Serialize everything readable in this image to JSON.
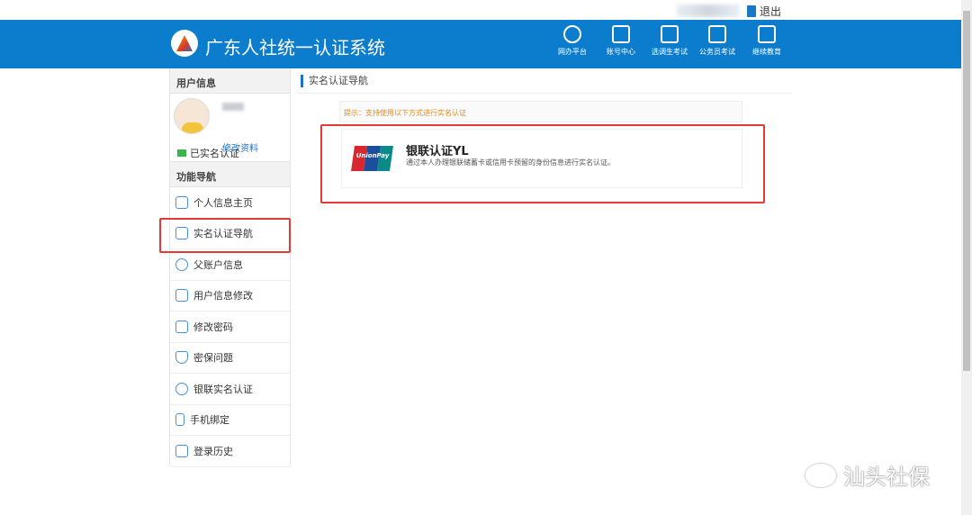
{
  "topbar": {
    "logout_label": "退出"
  },
  "header": {
    "title": "广东人社统一认证系统",
    "nav": [
      {
        "label": "网办平台",
        "icon": "person-circle-icon"
      },
      {
        "label": "账号中心",
        "icon": "account-card-icon"
      },
      {
        "label": "选调生考试",
        "icon": "exam-100-icon"
      },
      {
        "label": "公务员考试",
        "icon": "exam-100-icon"
      },
      {
        "label": "继续教育",
        "icon": "teacher-board-icon"
      }
    ]
  },
  "sidebar": {
    "user_section": "用户信息",
    "edit_profile": "修改资料",
    "verified": "已实名认证",
    "nav_section": "功能导航",
    "items": [
      {
        "label": "个人信息主页",
        "icon": "profile-icon"
      },
      {
        "label": "实名认证导航",
        "icon": "id-card-icon"
      },
      {
        "label": "父账户信息",
        "icon": "user-icon"
      },
      {
        "label": "用户信息修改",
        "icon": "pencil-icon"
      },
      {
        "label": "修改密码",
        "icon": "lock-icon"
      },
      {
        "label": "密保问题",
        "icon": "shield-icon"
      },
      {
        "label": "银联实名认证",
        "icon": "user-icon"
      },
      {
        "label": "手机绑定",
        "icon": "phone-icon"
      },
      {
        "label": "登录历史",
        "icon": "history-list-icon"
      }
    ]
  },
  "main": {
    "breadcrumb": "实名认证导航",
    "tip": "提示：支持使用以下方式进行实名认证",
    "option": {
      "title": "银联认证YL",
      "description": "通过本人办理银联储蓄卡或信用卡预留的身份信息进行实名认证。",
      "logo_text": "UnionPay 银联"
    }
  },
  "watermark": "汕头社保",
  "colors": {
    "header": "#0b7dcc",
    "highlight": "#e53935",
    "tip": "#e08a1e"
  }
}
